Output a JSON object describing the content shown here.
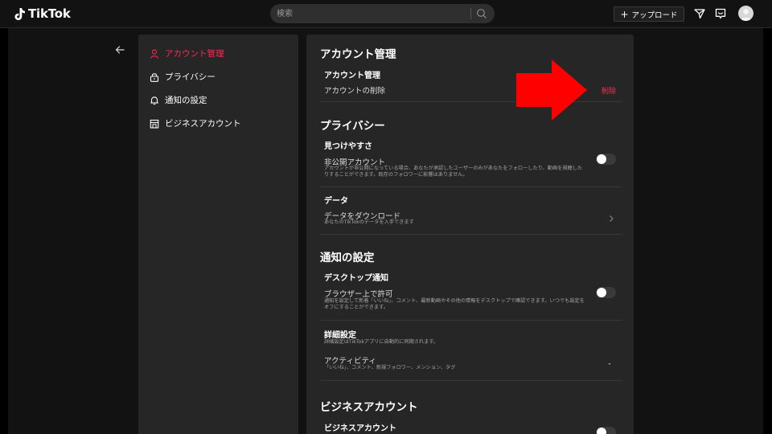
{
  "header": {
    "logo_text": "TikTok",
    "search": {
      "placeholder": "検索"
    },
    "upload_label": "アップロード",
    "icons": [
      "tiktok-note-icon",
      "search-icon",
      "plus-icon",
      "send-icon",
      "inbox-icon",
      "avatar"
    ]
  },
  "sidebar": {
    "items": [
      {
        "label": "アカウント管理",
        "icon": "person-icon",
        "active": true
      },
      {
        "label": "プライバシー",
        "icon": "lock-icon",
        "active": false
      },
      {
        "label": "通知の設定",
        "icon": "bell-icon",
        "active": false
      },
      {
        "label": "ビジネスアカウント",
        "icon": "store-icon",
        "active": false
      }
    ]
  },
  "main": {
    "account": {
      "title": "アカウント管理",
      "sub_title": "アカウント管理",
      "delete_label": "アカウントの削除",
      "delete_action": "削除"
    },
    "privacy": {
      "title": "プライバシー",
      "discover_title": "見つけやすさ",
      "private_label": "非公開アカウント",
      "private_desc": "アカウントが非公開になっている場合、あなたが承認したユーザーのみがあなたをフォローしたり、動画を視聴したりすることができます。既存のフォロワーに影響はありません。",
      "private_on": false,
      "data_title": "データ",
      "download_label": "データをダウンロード",
      "download_desc": "あなたのTikTokのデータを入手できます"
    },
    "notifications": {
      "title": "通知の設定",
      "desktop_title": "デスクトップ通知",
      "browser_label": "ブラウザー上で許可",
      "browser_desc": "通知を設定して新着「いいね」、コメント、最新動画やその他の情報をデスクトップで確認できます。いつでも設定をオフにすることができます。",
      "browser_on": false,
      "detail_title": "詳細設定",
      "detail_desc": "詳細設定はTikTokアプリに自動的に同期されます。",
      "activity_label": "アクティビティ",
      "activity_desc": "「いいね」、コメント、新規フォロワー、メンション、タグ"
    },
    "business": {
      "title": "ビジネスアカウント",
      "sub_title": "ビジネスアカウント"
    }
  },
  "colors": {
    "accent": "#fe2c55",
    "arrow": "#ff0000",
    "panel": "#262626",
    "page": "#121212"
  }
}
